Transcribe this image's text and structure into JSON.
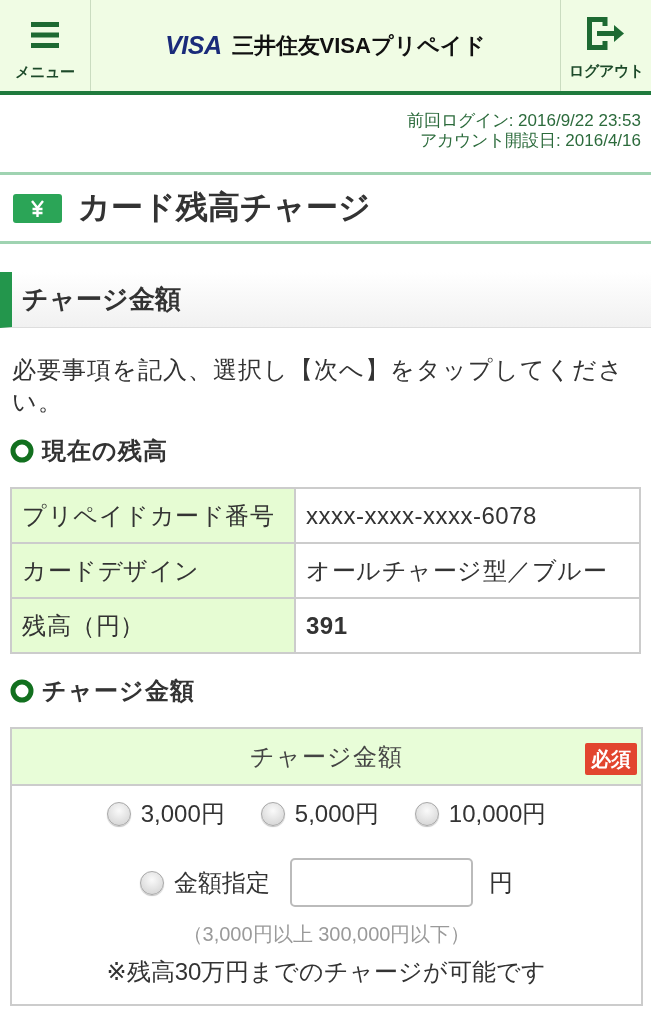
{
  "header": {
    "menu_label": "メニュー",
    "brand_mark": "VISA",
    "brand_name": "三井住友VISAプリペイド",
    "logout_label": "ログアウト"
  },
  "login_info": [
    "前回ログイン: 2016/9/22 23:53",
    "アカウント開設日: 2016/4/16"
  ],
  "page_title": "カード残高チャージ",
  "section_heading": "チャージ金額",
  "instruction": "必要事項を記入、選択し【次へ】をタップしてください。",
  "balance_section": {
    "title": "現在の残高",
    "rows": [
      {
        "label": "プリペイドカード番号",
        "value": "xxxx-xxxx-xxxx-6078",
        "emphasized": false
      },
      {
        "label": "カードデザイン",
        "value": "オールチャージ型／ブルー",
        "emphasized": false
      },
      {
        "label": "残高（円）",
        "value": "391",
        "emphasized": true
      }
    ]
  },
  "charge_section": {
    "title": "チャージ金額",
    "form": {
      "header": "チャージ金額",
      "required_badge": "必須",
      "options": [
        {
          "label": "3,000円",
          "selected": false
        },
        {
          "label": "5,000円",
          "selected": false
        },
        {
          "label": "10,000円",
          "selected": false
        }
      ],
      "custom_amount": {
        "label": "金額指定",
        "selected": false,
        "unit": "円"
      },
      "range_hint": "（3,000円以上 300,000円以下）",
      "note": "※残高30万円までのチャージが可能です"
    }
  }
}
